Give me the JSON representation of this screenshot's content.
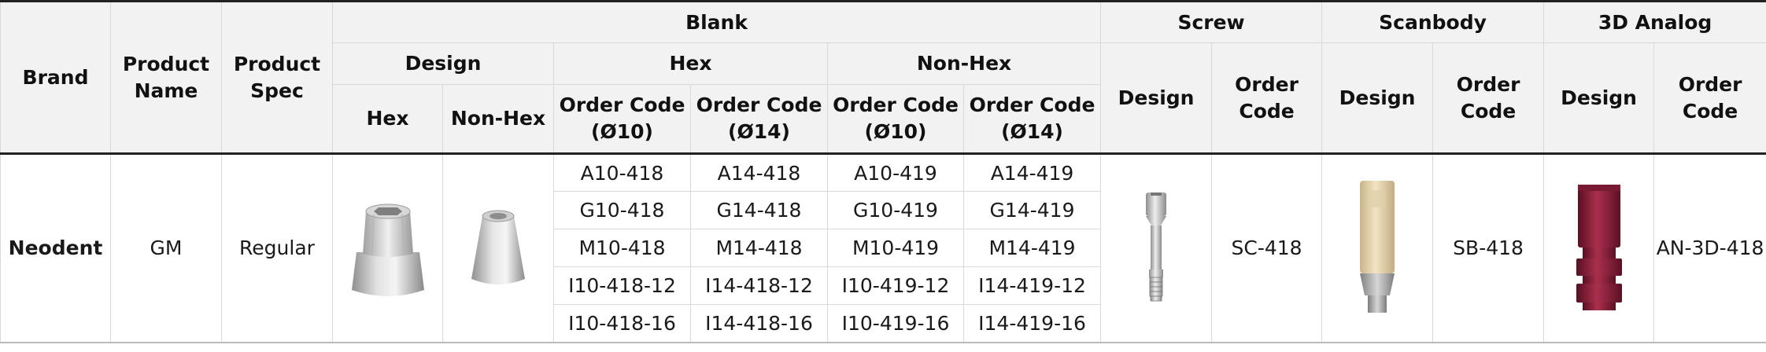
{
  "headers": {
    "brand": "Brand",
    "product_name": "Product Name",
    "product_spec": "Product Spec",
    "blank": "Blank",
    "blank_design": "Design",
    "blank_hex": "Hex",
    "blank_nonhex": "Non-Hex",
    "design_hex": "Hex",
    "design_nonhex": "Non-Hex",
    "order_code_10": "Order Code (Ø10)",
    "order_code_14": "Order Code (Ø14)",
    "screw": "Screw",
    "scanbody": "Scanbody",
    "analog_3d": "3D Analog",
    "design": "Design",
    "order_code": "Order Code"
  },
  "row": {
    "brand": "Neodent",
    "product_name": "GM",
    "product_spec": "Regular",
    "screw_code": "SC-418",
    "scanbody_code": "SB-418",
    "analog_code": "AN-3D-418"
  },
  "blank_codes": [
    [
      "A10-418",
      "A14-418",
      "A10-419",
      "A14-419"
    ],
    [
      "G10-418",
      "G14-418",
      "G10-419",
      "G14-419"
    ],
    [
      "M10-418",
      "M14-418",
      "M10-419",
      "M14-419"
    ],
    [
      "I10-418-12",
      "I14-418-12",
      "I10-419-12",
      "I14-419-12"
    ],
    [
      "I10-418-16",
      "I14-418-16",
      "I10-419-16",
      "I14-419-16"
    ]
  ],
  "images": {
    "hex_blank": "hex-blank-icon",
    "nonhex_blank": "nonhex-blank-icon",
    "screw": "screw-icon",
    "scanbody": "scanbody-icon",
    "analog": "analog-icon"
  }
}
